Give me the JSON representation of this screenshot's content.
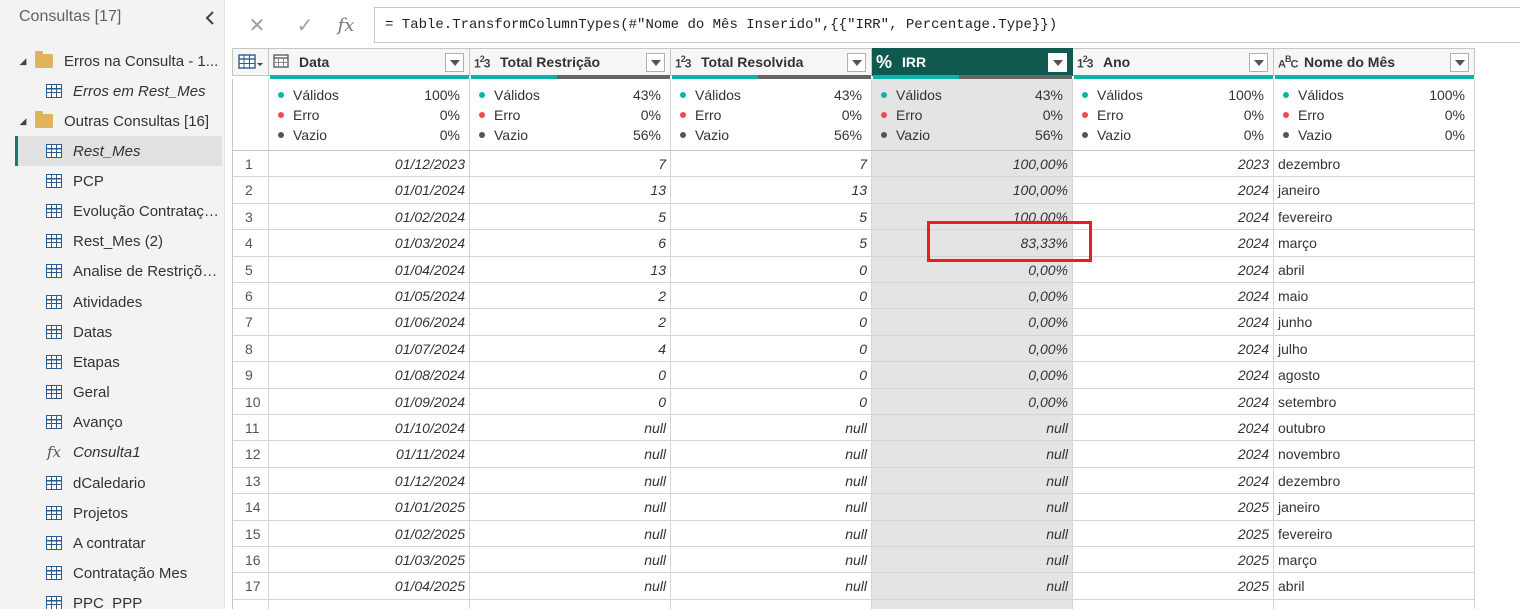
{
  "queries_pane": {
    "title": "Consultas [17]",
    "items": [
      {
        "type": "group",
        "label": "Erros na Consulta - 1...",
        "expanded": true
      },
      {
        "type": "table",
        "label": "Erros em Rest_Mes",
        "italic": true,
        "indent": 1
      },
      {
        "type": "group",
        "label": "Outras Consultas [16]",
        "expanded": true
      },
      {
        "type": "table",
        "label": "Rest_Mes",
        "italic": true,
        "indent": 1,
        "selected": true
      },
      {
        "type": "table",
        "label": "PCP",
        "indent": 1
      },
      {
        "type": "table",
        "label": "Evolução Contrataçã...",
        "indent": 1
      },
      {
        "type": "table",
        "label": "Rest_Mes (2)",
        "indent": 1
      },
      {
        "type": "table",
        "label": "Analise de Restriçõe...",
        "indent": 1
      },
      {
        "type": "table",
        "label": "Atividades",
        "indent": 1
      },
      {
        "type": "table",
        "label": "Datas",
        "indent": 1
      },
      {
        "type": "table",
        "label": "Etapas",
        "indent": 1
      },
      {
        "type": "table",
        "label": "Geral",
        "indent": 1
      },
      {
        "type": "table",
        "label": "Avanço",
        "indent": 1
      },
      {
        "type": "function",
        "label": "Consulta1",
        "italic": true,
        "indent": 1
      },
      {
        "type": "table",
        "label": "dCaledario",
        "indent": 1
      },
      {
        "type": "table",
        "label": "Projetos",
        "indent": 1
      },
      {
        "type": "table",
        "label": "A contratar",
        "indent": 1
      },
      {
        "type": "table",
        "label": "Contratação Mes",
        "indent": 1
      },
      {
        "type": "table",
        "label": "PPC_PPP",
        "indent": 1
      }
    ]
  },
  "formula_bar": {
    "cancel_icon": "✕",
    "confirm_icon": "✓",
    "fx_label": "fx",
    "formula": "= Table.TransformColumnTypes(#\"Nome do Mês Inserido\",{{\"IRR\", Percentage.Type}})"
  },
  "profile_labels": {
    "valid": "Válidos",
    "error": "Erro",
    "empty": "Vazio"
  },
  "profile_colors": {
    "valid": "#0ab5a5",
    "error": "#f04b4b",
    "empty": "#555555"
  },
  "columns": [
    {
      "name": "Data",
      "type_icon": "calendar-table-icon",
      "align": "r",
      "width": 201,
      "profile": {
        "valid": "100%",
        "error": "0%",
        "empty": "0%"
      },
      "valid_fraction": 1.0
    },
    {
      "name": "Total Restrição",
      "type_icon": "1²3",
      "align": "r",
      "width": 201,
      "profile": {
        "valid": "43%",
        "error": "0%",
        "empty": "56%"
      },
      "valid_fraction": 0.43
    },
    {
      "name": "Total Resolvida",
      "type_icon": "1²3",
      "align": "r",
      "width": 201,
      "profile": {
        "valid": "43%",
        "error": "0%",
        "empty": "56%"
      },
      "valid_fraction": 0.43
    },
    {
      "name": "IRR",
      "type_icon": "%",
      "align": "r",
      "width": 201,
      "selected": true,
      "profile": {
        "valid": "43%",
        "error": "0%",
        "empty": "56%"
      },
      "valid_fraction": 0.43
    },
    {
      "name": "Ano",
      "type_icon": "1²3",
      "align": "r",
      "width": 201,
      "profile": {
        "valid": "100%",
        "error": "0%",
        "empty": "0%"
      },
      "valid_fraction": 1.0
    },
    {
      "name": "Nome do Mês",
      "type_icon": "ABC",
      "align": "l",
      "width": 201,
      "profile": {
        "valid": "100%",
        "error": "0%",
        "empty": "0%"
      },
      "valid_fraction": 1.0
    }
  ],
  "rows": [
    [
      "01/12/2023",
      "7",
      "7",
      "100,00%",
      "2023",
      "dezembro"
    ],
    [
      "01/01/2024",
      "13",
      "13",
      "100,00%",
      "2024",
      "janeiro"
    ],
    [
      "01/02/2024",
      "5",
      "5",
      "100,00%",
      "2024",
      "fevereiro"
    ],
    [
      "01/03/2024",
      "6",
      "5",
      "83,33%",
      "2024",
      "março"
    ],
    [
      "01/04/2024",
      "13",
      "0",
      "0,00%",
      "2024",
      "abril"
    ],
    [
      "01/05/2024",
      "2",
      "0",
      "0,00%",
      "2024",
      "maio"
    ],
    [
      "01/06/2024",
      "2",
      "0",
      "0,00%",
      "2024",
      "junho"
    ],
    [
      "01/07/2024",
      "4",
      "0",
      "0,00%",
      "2024",
      "julho"
    ],
    [
      "01/08/2024",
      "0",
      "0",
      "0,00%",
      "2024",
      "agosto"
    ],
    [
      "01/09/2024",
      "0",
      "0",
      "0,00%",
      "2024",
      "setembro"
    ],
    [
      "01/10/2024",
      "null",
      "null",
      "null",
      "2024",
      "outubro"
    ],
    [
      "01/11/2024",
      "null",
      "null",
      "null",
      "2024",
      "novembro"
    ],
    [
      "01/12/2024",
      "null",
      "null",
      "null",
      "2024",
      "dezembro"
    ],
    [
      "01/01/2025",
      "null",
      "null",
      "null",
      "2025",
      "janeiro"
    ],
    [
      "01/02/2025",
      "null",
      "null",
      "null",
      "2025",
      "fevereiro"
    ],
    [
      "01/03/2025",
      "null",
      "null",
      "null",
      "2025",
      "março"
    ],
    [
      "01/04/2025",
      "null",
      "null",
      "null",
      "2025",
      "abril"
    ]
  ],
  "highlight": {
    "row_index": 3,
    "column": "IRR",
    "color": "#ee1c1c"
  }
}
